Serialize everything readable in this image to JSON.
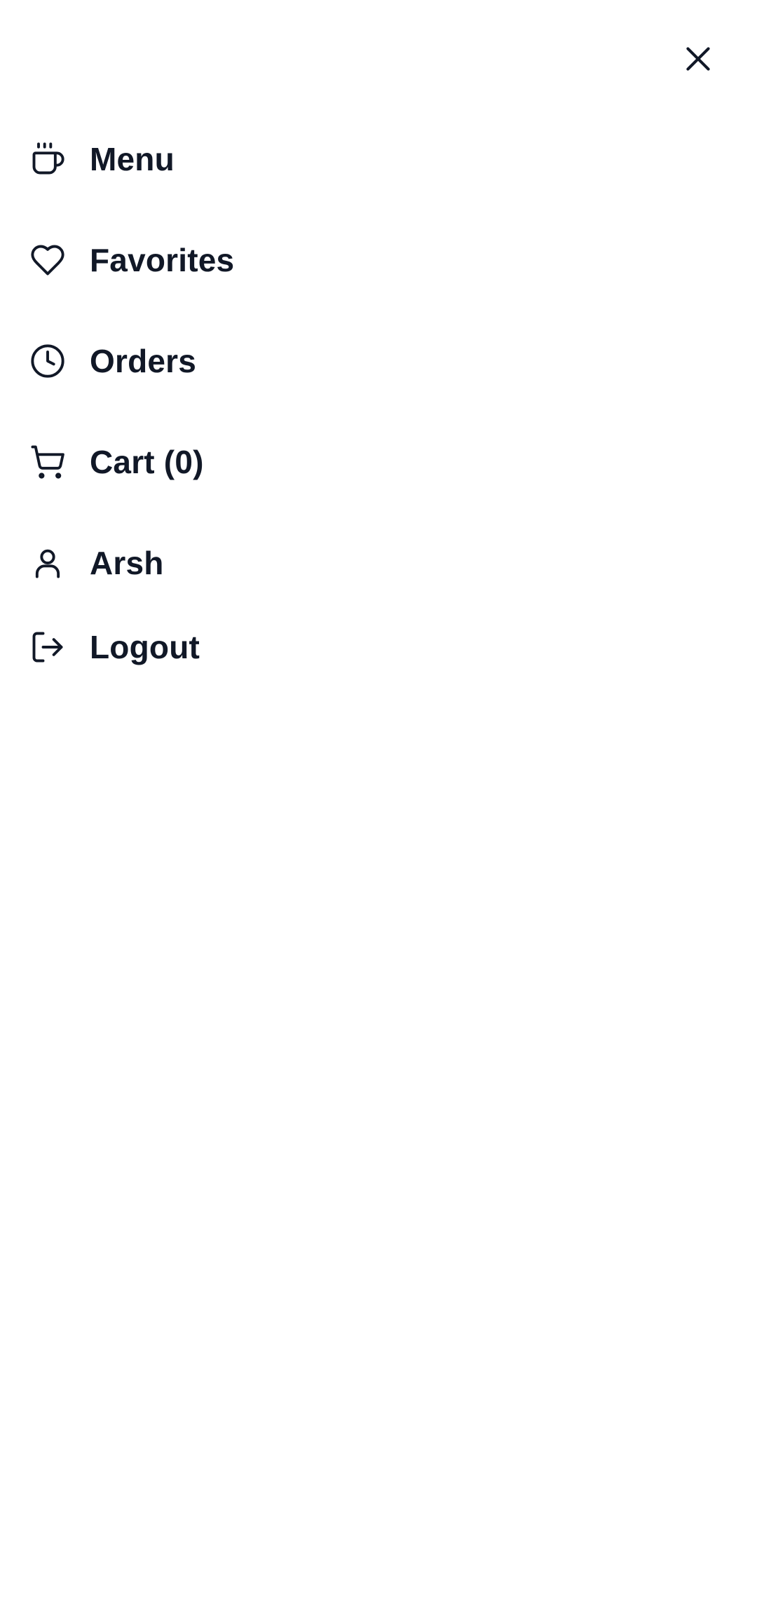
{
  "drawer": {
    "close_icon": "close-icon",
    "items": [
      {
        "label": "Menu",
        "icon": "coffee-cup-icon"
      },
      {
        "label": "Favorites",
        "icon": "heart-icon"
      },
      {
        "label": "Orders",
        "icon": "clock-icon"
      },
      {
        "label": "Cart (0)",
        "icon": "cart-icon"
      },
      {
        "label": "Arsh",
        "icon": "user-icon"
      },
      {
        "label": "Logout",
        "icon": "logout-icon"
      }
    ]
  },
  "colors": {
    "text": "#111827",
    "background": "#ffffff"
  }
}
